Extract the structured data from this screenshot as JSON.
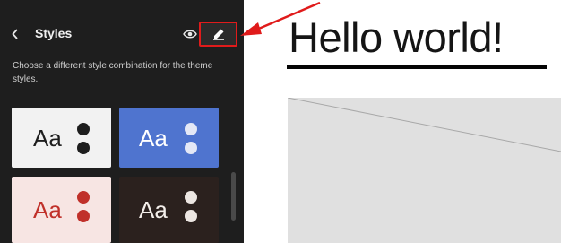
{
  "sidebar": {
    "title": "Styles",
    "description": "Choose a different style combination for the theme styles.",
    "variations": [
      {
        "label": "Aa",
        "background": "#f2f2f2",
        "text_color": "#1e1e1e",
        "dot_color": "#1e1e1e"
      },
      {
        "label": "Aa",
        "background": "#4f74cf",
        "text_color": "#ffffff",
        "dot_color": "#e4e8f6"
      },
      {
        "label": "Aa",
        "background": "#f7e5e3",
        "text_color": "#c0302a",
        "dot_color": "#c0302a"
      },
      {
        "label": "Aa",
        "background": "#2b211e",
        "text_color": "#f3eeea",
        "dot_color": "#ece6e2"
      }
    ],
    "icons": {
      "back": "chevron-left-icon",
      "preview": "eye-icon",
      "edit": "pencil-icon"
    }
  },
  "canvas": {
    "heading": "Hello world!"
  },
  "colors": {
    "sidebar_bg": "#1e1e1e",
    "highlight": "#e01b1b",
    "annotation_arrow": "#e01b1b"
  }
}
